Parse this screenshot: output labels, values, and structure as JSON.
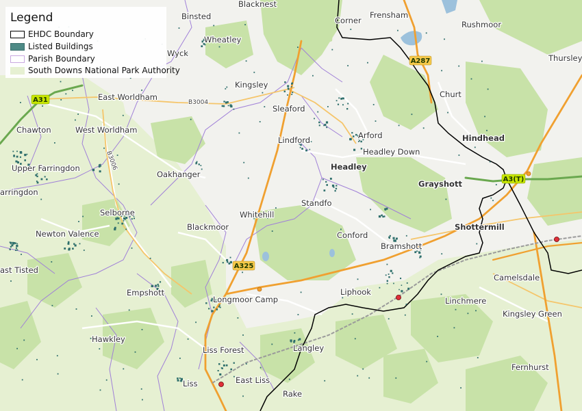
{
  "legend": {
    "title": "Legend",
    "items": [
      {
        "label": "EHDC Boundary",
        "fill": "#ffffff",
        "stroke": "#000000"
      },
      {
        "label": "Listed Buildings",
        "fill": "#4e8a86",
        "stroke": "#3a6e6b"
      },
      {
        "label": "Parish Boundary",
        "fill": "#ffffff",
        "stroke": "#c9a8e0"
      },
      {
        "label": "South Downs National Park Authority",
        "fill": "#e6f0d2",
        "stroke": "#e6f0d2"
      }
    ]
  },
  "colors": {
    "map_background": "#f2f2ee",
    "national_park_tint": "#e6f0d2",
    "woodland": "#c8e2a8",
    "a_road": "#f0a030",
    "b_road": "#f5c56a",
    "parish_boundary": "#a080d8",
    "ehdc_boundary": "#000000",
    "listed_building": "#2f6f6c",
    "water": "#9cc1dc",
    "railway": "#9a9a9a",
    "station": "#e0303a"
  },
  "places": [
    {
      "name": "Binsted",
      "bold": false
    },
    {
      "name": "Blacknest",
      "bold": false
    },
    {
      "name": "Corner",
      "bold": false
    },
    {
      "name": "Frensham",
      "bold": false
    },
    {
      "name": "Rushmoor",
      "bold": false
    },
    {
      "name": "Thursley",
      "bold": false
    },
    {
      "name": "Wheatley",
      "bold": false
    },
    {
      "name": "Wyck",
      "bold": false
    },
    {
      "name": "Kingsley",
      "bold": false
    },
    {
      "name": "East Worldham",
      "bold": false
    },
    {
      "name": "Sleaford",
      "bold": false
    },
    {
      "name": "Churt",
      "bold": false
    },
    {
      "name": "Chawton",
      "bold": false
    },
    {
      "name": "West Worldham",
      "bold": false
    },
    {
      "name": "Arford",
      "bold": false
    },
    {
      "name": "Hindhead",
      "bold": true
    },
    {
      "name": "Lindford",
      "bold": false
    },
    {
      "name": "Headley Down",
      "bold": false
    },
    {
      "name": "Upper Farringdon",
      "bold": false
    },
    {
      "name": "Headley",
      "bold": true
    },
    {
      "name": "Oakhanger",
      "bold": false
    },
    {
      "name": "Grayshott",
      "bold": true
    },
    {
      "name": "arringdon",
      "bold": false
    },
    {
      "name": "Standfo",
      "bold": false
    },
    {
      "name": "Selborne",
      "bold": false
    },
    {
      "name": "Whitehill",
      "bold": false
    },
    {
      "name": "Blackmoor",
      "bold": false
    },
    {
      "name": "Shottermill",
      "bold": true
    },
    {
      "name": "Newton Valence",
      "bold": false
    },
    {
      "name": "Conford",
      "bold": false
    },
    {
      "name": "Bramshott",
      "bold": false
    },
    {
      "name": "ast Tisted",
      "bold": false
    },
    {
      "name": "Camelsdale",
      "bold": false
    },
    {
      "name": "Empshott",
      "bold": false
    },
    {
      "name": "Liphook",
      "bold": false
    },
    {
      "name": "Longmoor Camp",
      "bold": false
    },
    {
      "name": "Linchmere",
      "bold": false
    },
    {
      "name": "Kingsley Green",
      "bold": false
    },
    {
      "name": "Hawkley",
      "bold": false
    },
    {
      "name": "Langley",
      "bold": false
    },
    {
      "name": "Liss Forest",
      "bold": false
    },
    {
      "name": "Fernhurst",
      "bold": false
    },
    {
      "name": "East Liss",
      "bold": false
    },
    {
      "name": "Liss",
      "bold": false
    },
    {
      "name": "Rake",
      "bold": false
    }
  ],
  "road_labels": [
    {
      "ref": "A31",
      "class": "green"
    },
    {
      "ref": "A287",
      "class": "a"
    },
    {
      "ref": "A3(T)",
      "class": "green"
    },
    {
      "ref": "A325",
      "class": "a"
    },
    {
      "ref": "B3004",
      "class": "b"
    },
    {
      "ref": "B3006",
      "class": "b"
    }
  ]
}
